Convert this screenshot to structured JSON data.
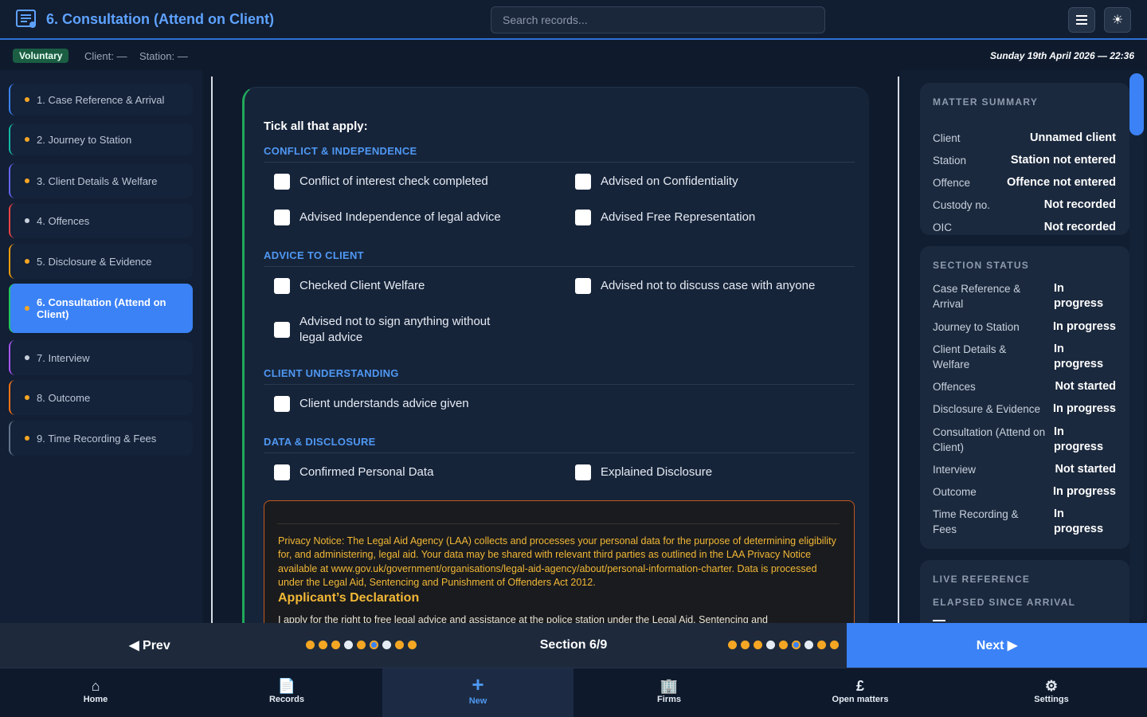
{
  "header": {
    "title": "6. Consultation (Attend on Client)",
    "search_placeholder": "Search records...",
    "menu_icon": "menu-icon",
    "theme_icon": "sun-icon"
  },
  "status": {
    "badge": "Voluntary",
    "client": "Client: —",
    "station": "Station: —",
    "datetime": "Sunday 19th April 2026 — 22:36"
  },
  "sidebar": {
    "items": [
      {
        "label": "1. Case Reference & Arrival",
        "color": "#3b82f6",
        "dot": "#f5a623"
      },
      {
        "label": "2. Journey to Station",
        "color": "#14b8a6",
        "dot": "#f5a623"
      },
      {
        "label": "3. Client Details & Welfare",
        "color": "#6366f1",
        "dot": "#f5a623"
      },
      {
        "label": "4. Offences",
        "color": "#ef4444",
        "dot": "#c8d0dc"
      },
      {
        "label": "5. Disclosure & Evidence",
        "color": "#f59e0b",
        "dot": "#f5a623"
      },
      {
        "label": "6. Consultation (Attend on Client)",
        "color": "#22c55e",
        "dot": "#f5a623"
      },
      {
        "label": "7. Interview",
        "color": "#a855f7",
        "dot": "#c8d0dc"
      },
      {
        "label": "8. Outcome",
        "color": "#f97316",
        "dot": "#f5a623"
      },
      {
        "label": "9. Time Recording & Fees",
        "color": "#64748b",
        "dot": "#f5a623"
      }
    ]
  },
  "form": {
    "tick_heading": "Tick all that apply:",
    "groups": [
      {
        "title": "CONFLICT & INDEPENDENCE",
        "items": [
          "Conflict of interest check completed",
          "Advised on Confidentiality",
          "Advised Independence of legal advice",
          "Advised Free Representation"
        ]
      },
      {
        "title": "ADVICE TO CLIENT",
        "items": [
          "Checked Client Welfare",
          "Advised not to discuss case with anyone",
          "Advised not to sign anything without legal advice"
        ]
      },
      {
        "title": "CLIENT UNDERSTANDING",
        "items": [
          "Client understands advice given"
        ]
      },
      {
        "title": "DATA & DISCLOSURE",
        "items": [
          "Confirmed Personal Data",
          "Explained Disclosure"
        ]
      }
    ],
    "privacy_notice": "Privacy Notice: The Legal Aid Agency (LAA) collects and processes your personal data for the purpose of determining eligibility for, and administering, legal aid. Your data may be shared with relevant third parties as outlined in the LAA Privacy Notice available at www.gov.uk/government/organisations/legal-aid-agency/about/personal-information-charter. Data is processed under the Legal Aid, Sentencing and Punishment of Offenders Act 2012.",
    "declaration_title": "Applicant’s Declaration",
    "declaration_text": "I apply for the right to free legal advice and assistance at the police station under the Legal Aid, Sentencing and"
  },
  "matter_summary": {
    "title": "MATTER SUMMARY",
    "rows": [
      {
        "k": "Client",
        "v": "Unnamed client"
      },
      {
        "k": "Station",
        "v": "Station not entered"
      },
      {
        "k": "Offence",
        "v": "Offence not entered"
      },
      {
        "k": "Custody no.",
        "v": "Not recorded"
      },
      {
        "k": "OIC",
        "v": "Not recorded"
      }
    ]
  },
  "section_status": {
    "title": "SECTION STATUS",
    "rows": [
      {
        "k": "Case Reference & Arrival",
        "v": "In progress"
      },
      {
        "k": "Journey to Station",
        "v": "In progress"
      },
      {
        "k": "Client Details & Welfare",
        "v": "In progress"
      },
      {
        "k": "Offences",
        "v": "Not started"
      },
      {
        "k": "Disclosure & Evidence",
        "v": "In progress"
      },
      {
        "k": "Consultation (Attend on Client)",
        "v": "In progress"
      },
      {
        "k": "Interview",
        "v": "Not started"
      },
      {
        "k": "Outcome",
        "v": "In progress"
      },
      {
        "k": "Time Recording & Fees",
        "v": "In progress"
      }
    ]
  },
  "live_reference": {
    "title": "LIVE REFERENCE",
    "subtitle": "ELAPSED SINCE ARRIVAL"
  },
  "pager": {
    "prev": "◀ Prev",
    "next": "Next ▶",
    "section": "Section 6/9",
    "dot_colors": [
      "#f5a623",
      "#f5a623",
      "#f5a623",
      "#e6ecf4",
      "#f5a623",
      "#3b82f6",
      "#e6ecf4",
      "#f5a623",
      "#f5a623"
    ]
  },
  "bottom_nav": [
    {
      "label": "Home",
      "icon": "home-icon",
      "glyph": "⌂"
    },
    {
      "label": "Records",
      "icon": "document-icon",
      "glyph": "📄"
    },
    {
      "label": "New",
      "icon": "plus-icon",
      "glyph": "+"
    },
    {
      "label": "Firms",
      "icon": "building-icon",
      "glyph": "🏢"
    },
    {
      "label": "Open matters",
      "icon": "pound-icon",
      "glyph": "£"
    },
    {
      "label": "Settings",
      "icon": "gear-icon",
      "glyph": "⚙"
    }
  ]
}
